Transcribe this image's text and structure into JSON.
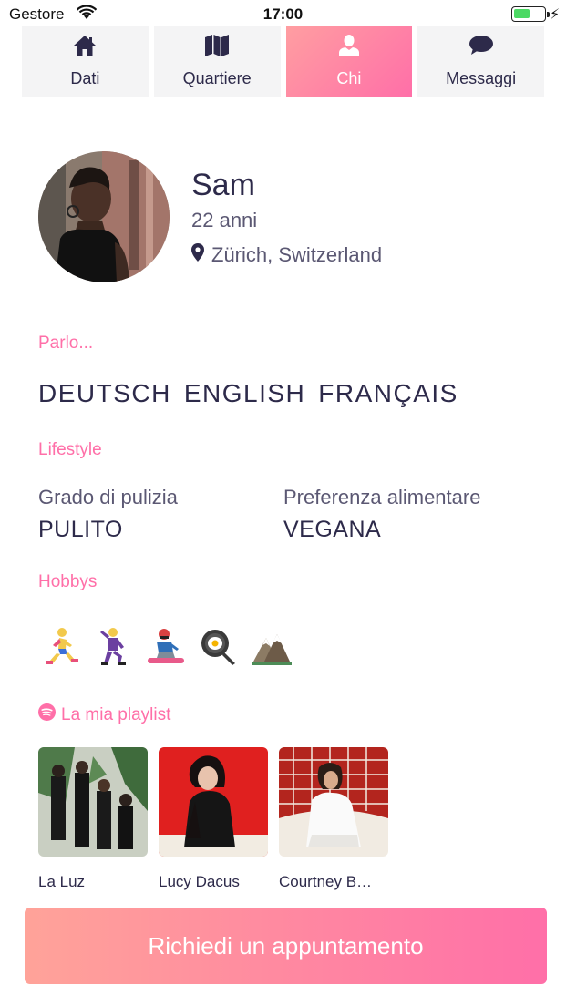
{
  "status_bar": {
    "carrier": "Gestore",
    "time": "17:00",
    "battery_level": 0.55
  },
  "tabs": [
    {
      "label": "Dati",
      "icon": "home-icon",
      "active": false
    },
    {
      "label": "Quartiere",
      "icon": "map-icon",
      "active": false
    },
    {
      "label": "Chi",
      "icon": "person-icon",
      "active": true
    },
    {
      "label": "Messaggi",
      "icon": "chat-bubble-icon",
      "active": false
    }
  ],
  "profile": {
    "name": "Sam",
    "age": "22 anni",
    "location": "Zürich, Switzerland"
  },
  "languages": {
    "label": "Parlo...",
    "items": [
      "DEUTSCH",
      "ENGLISH",
      "FRANÇAIS"
    ]
  },
  "lifestyle": {
    "label": "Lifestyle",
    "cleanliness": {
      "title": "Grado di pulizia",
      "value": "PULITO"
    },
    "diet": {
      "title": "Preferenza alimentare",
      "value": "VEGANA"
    }
  },
  "hobbies": {
    "label": "Hobbys",
    "items": [
      "running-icon",
      "dancing-icon",
      "snowboarding-icon",
      "cooking-icon",
      "mountains-icon"
    ]
  },
  "playlist": {
    "label": "La mia playlist",
    "albums": [
      {
        "name": "La Luz"
      },
      {
        "name": "Lucy Dacus"
      },
      {
        "name": "Courtney B…"
      }
    ]
  },
  "cta": {
    "label": "Richiedi un appuntamento"
  },
  "colors": {
    "accent": "#ff6fa8",
    "accent_light": "#ffa399",
    "text": "#2d2a4a",
    "tab_bg": "#f4f4f5"
  }
}
